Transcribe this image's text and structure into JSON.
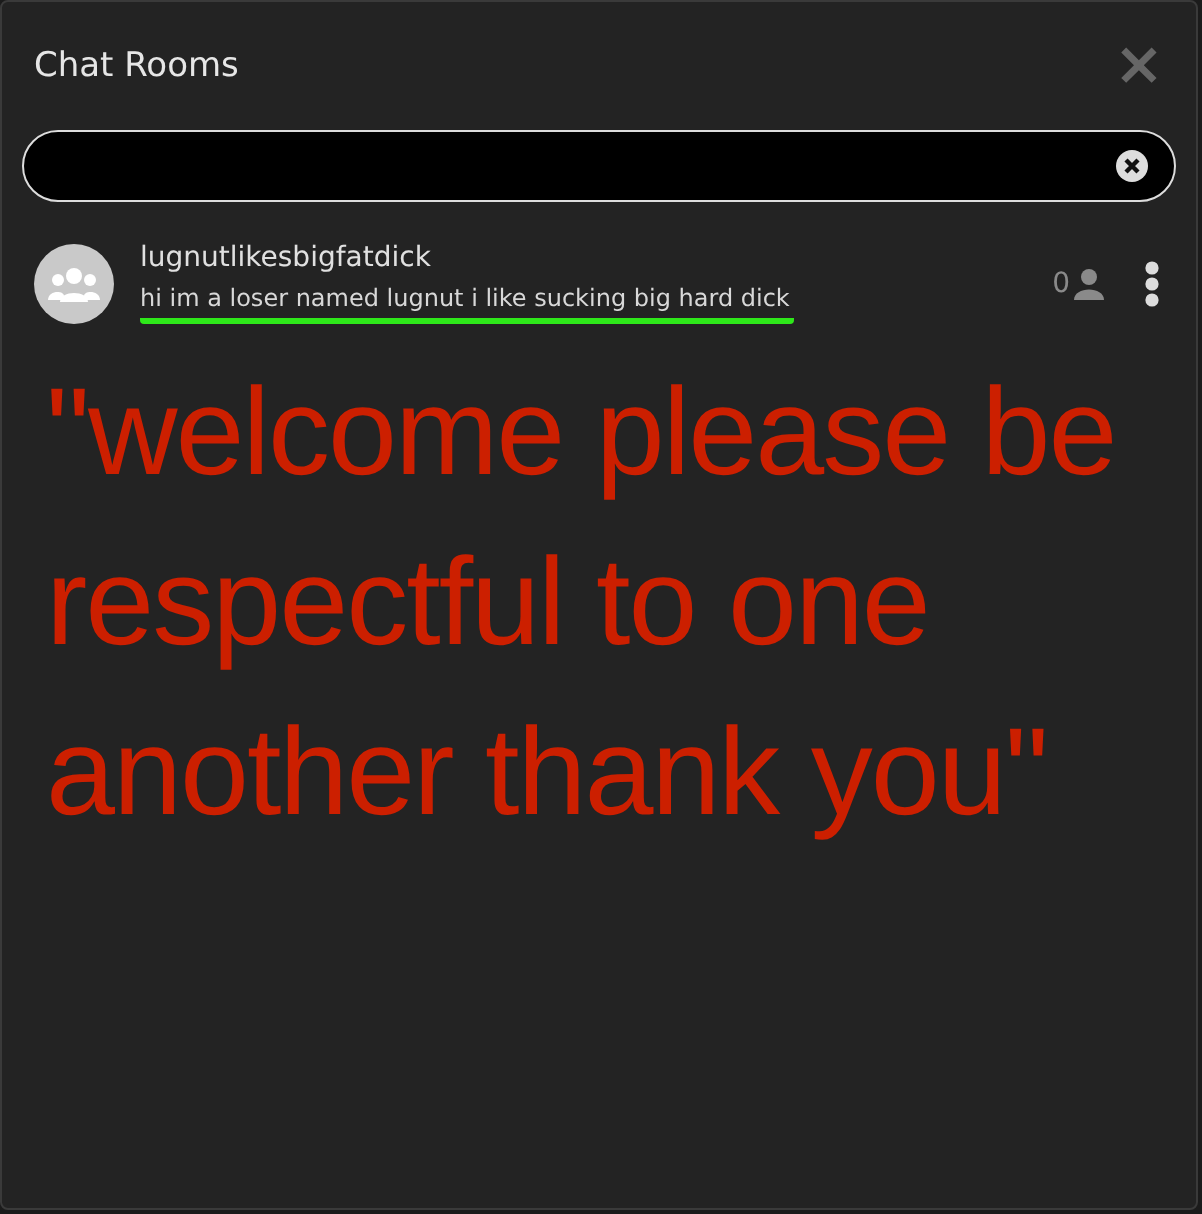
{
  "dialog": {
    "title": "Chat Rooms",
    "close": "×"
  },
  "search": {
    "kind": "empty"
  },
  "rooms": [
    {
      "name": "lugnutlikesbigfatdick",
      "description": "hi im a loser named lugnut i like sucking big hard dick",
      "user_count": "0",
      "underlined": true
    }
  ],
  "overlay_text": "\"welcome please be respectful to one another thank you\""
}
